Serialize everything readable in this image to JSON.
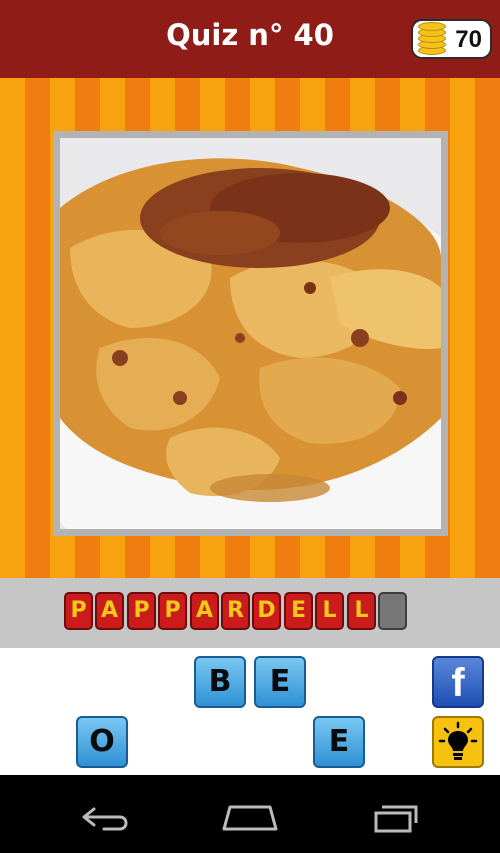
{
  "header": {
    "title": "Quiz n° 40",
    "coins": "70",
    "coin_icon": "coin-stack-icon"
  },
  "puzzle": {
    "image": "plate of pappardelle with meat sauce photo"
  },
  "answer": {
    "letters": [
      "P",
      "A",
      "P",
      "P",
      "A",
      "R",
      "D",
      "E",
      "L",
      "L",
      ""
    ]
  },
  "keyboard": {
    "keys": [
      "B",
      "E",
      "O",
      "E"
    ],
    "facebook_label": "f"
  },
  "navigation": {
    "icons": [
      "back-icon",
      "home-icon",
      "recent-apps-icon"
    ]
  },
  "colors": {
    "header": "#8f1c17",
    "stripe_light": "#f7a20e",
    "stripe_dark": "#ef7d0f",
    "slot_red": "#cc1b1b",
    "slot_letter": "#f1c91a",
    "key_blue": "#2f91d4",
    "hint_yellow": "#f6c20f"
  }
}
